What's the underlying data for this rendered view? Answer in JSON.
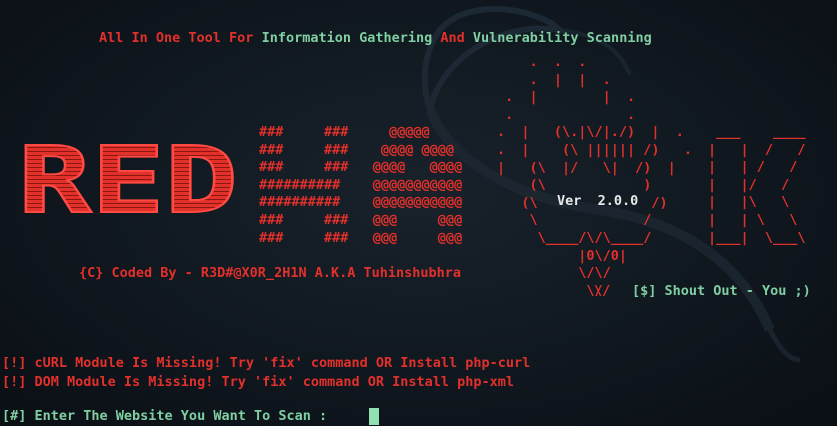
{
  "tagline": {
    "part1": "All In One Tool For ",
    "part2": "Information Gathering",
    "part3": " And ",
    "part4": "Vulnerability Scanning"
  },
  "logo": {
    "big_word": "RED",
    "hash_art": "###     ###     @@@@@\n###     ###    @@@@ @@@@\n###     ###   @@@@   @@@@\n##########    @@@@@@@@@@@\n##########    @@@@@@@@@@@\n###     ###   @@@     @@@\n###     ###   @@@     @@@",
    "owl_art": "    .  .  .\n    .  |  |  .\n .  |        |  .\n .              .\n.  |   (\\.|\\/|./)  |  .\n.  |    (\\ |||||| /)   .\n|   (\\  |/   \\|  /)  |\n    (\\            )\n   (\\              /)\n    \\             /\n     \\____/\\/\\____/\n          |0\\/0|\n          \\/\\/\n           \\/",
    "k_art": " ___    ____\n|   |  /   /\n|   | /   /\n|   |/   /\n|   |\\   \\\n|   | \\   \\\n|___|  \\___\\",
    "version": "Ver  2.0.0"
  },
  "credit": "{C} Coded By - R3D#@X0R_2H1N A.K.A Tuhinshubhra",
  "shout": {
    "prefix": "\\/",
    "text": "[$] Shout Out - You ;)"
  },
  "errors": [
    "[!] cURL Module Is Missing! Try 'fix' command OR Install php-curl",
    "[!] DOM Module Is Missing! Try 'fix' command OR Install php-xml"
  ],
  "prompt": {
    "text": "[#] Enter The Website You Want To Scan : ",
    "value": ""
  },
  "colors": {
    "accent_red": "#e2302b",
    "accent_green": "#7fcfa3",
    "background": "#0b1117"
  },
  "icons": {
    "background": "kali-dragon-icon"
  }
}
